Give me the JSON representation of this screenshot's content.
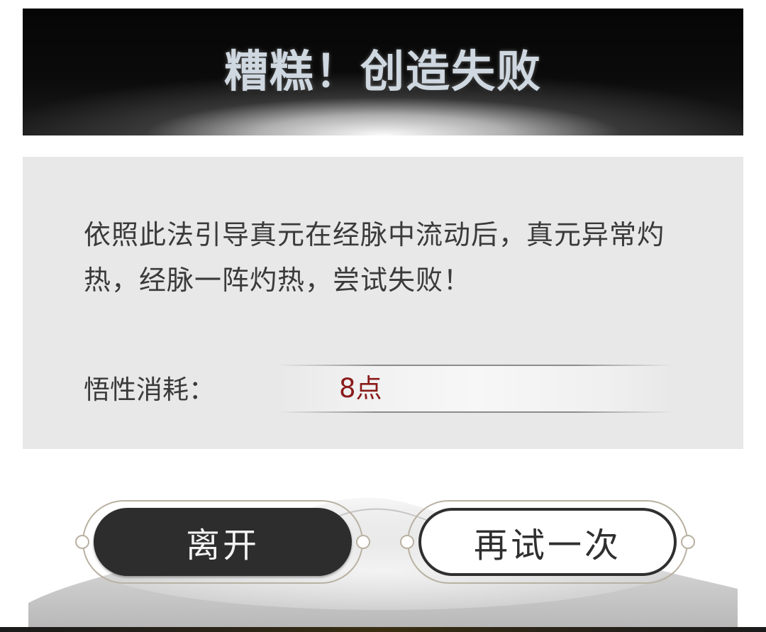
{
  "dialog": {
    "title": "糟糕！创造失败",
    "message": "依照此法引导真元在经脉中流动后，真元异常灼热，经脉一阵灼热，尝试失败！",
    "cost_label": "悟性消耗：",
    "cost_value": "8点"
  },
  "buttons": {
    "leave_label": "离开",
    "retry_label": "再试一次"
  },
  "colors": {
    "banner_bg": "#0b0b0b",
    "panel_bg": "#e8e8e8",
    "cost_value_text": "#8b1a1a",
    "leave_button_bg": "#2d2d2d",
    "retry_button_border": "#2f2f2f",
    "frame_line": "#b9b1a2"
  }
}
